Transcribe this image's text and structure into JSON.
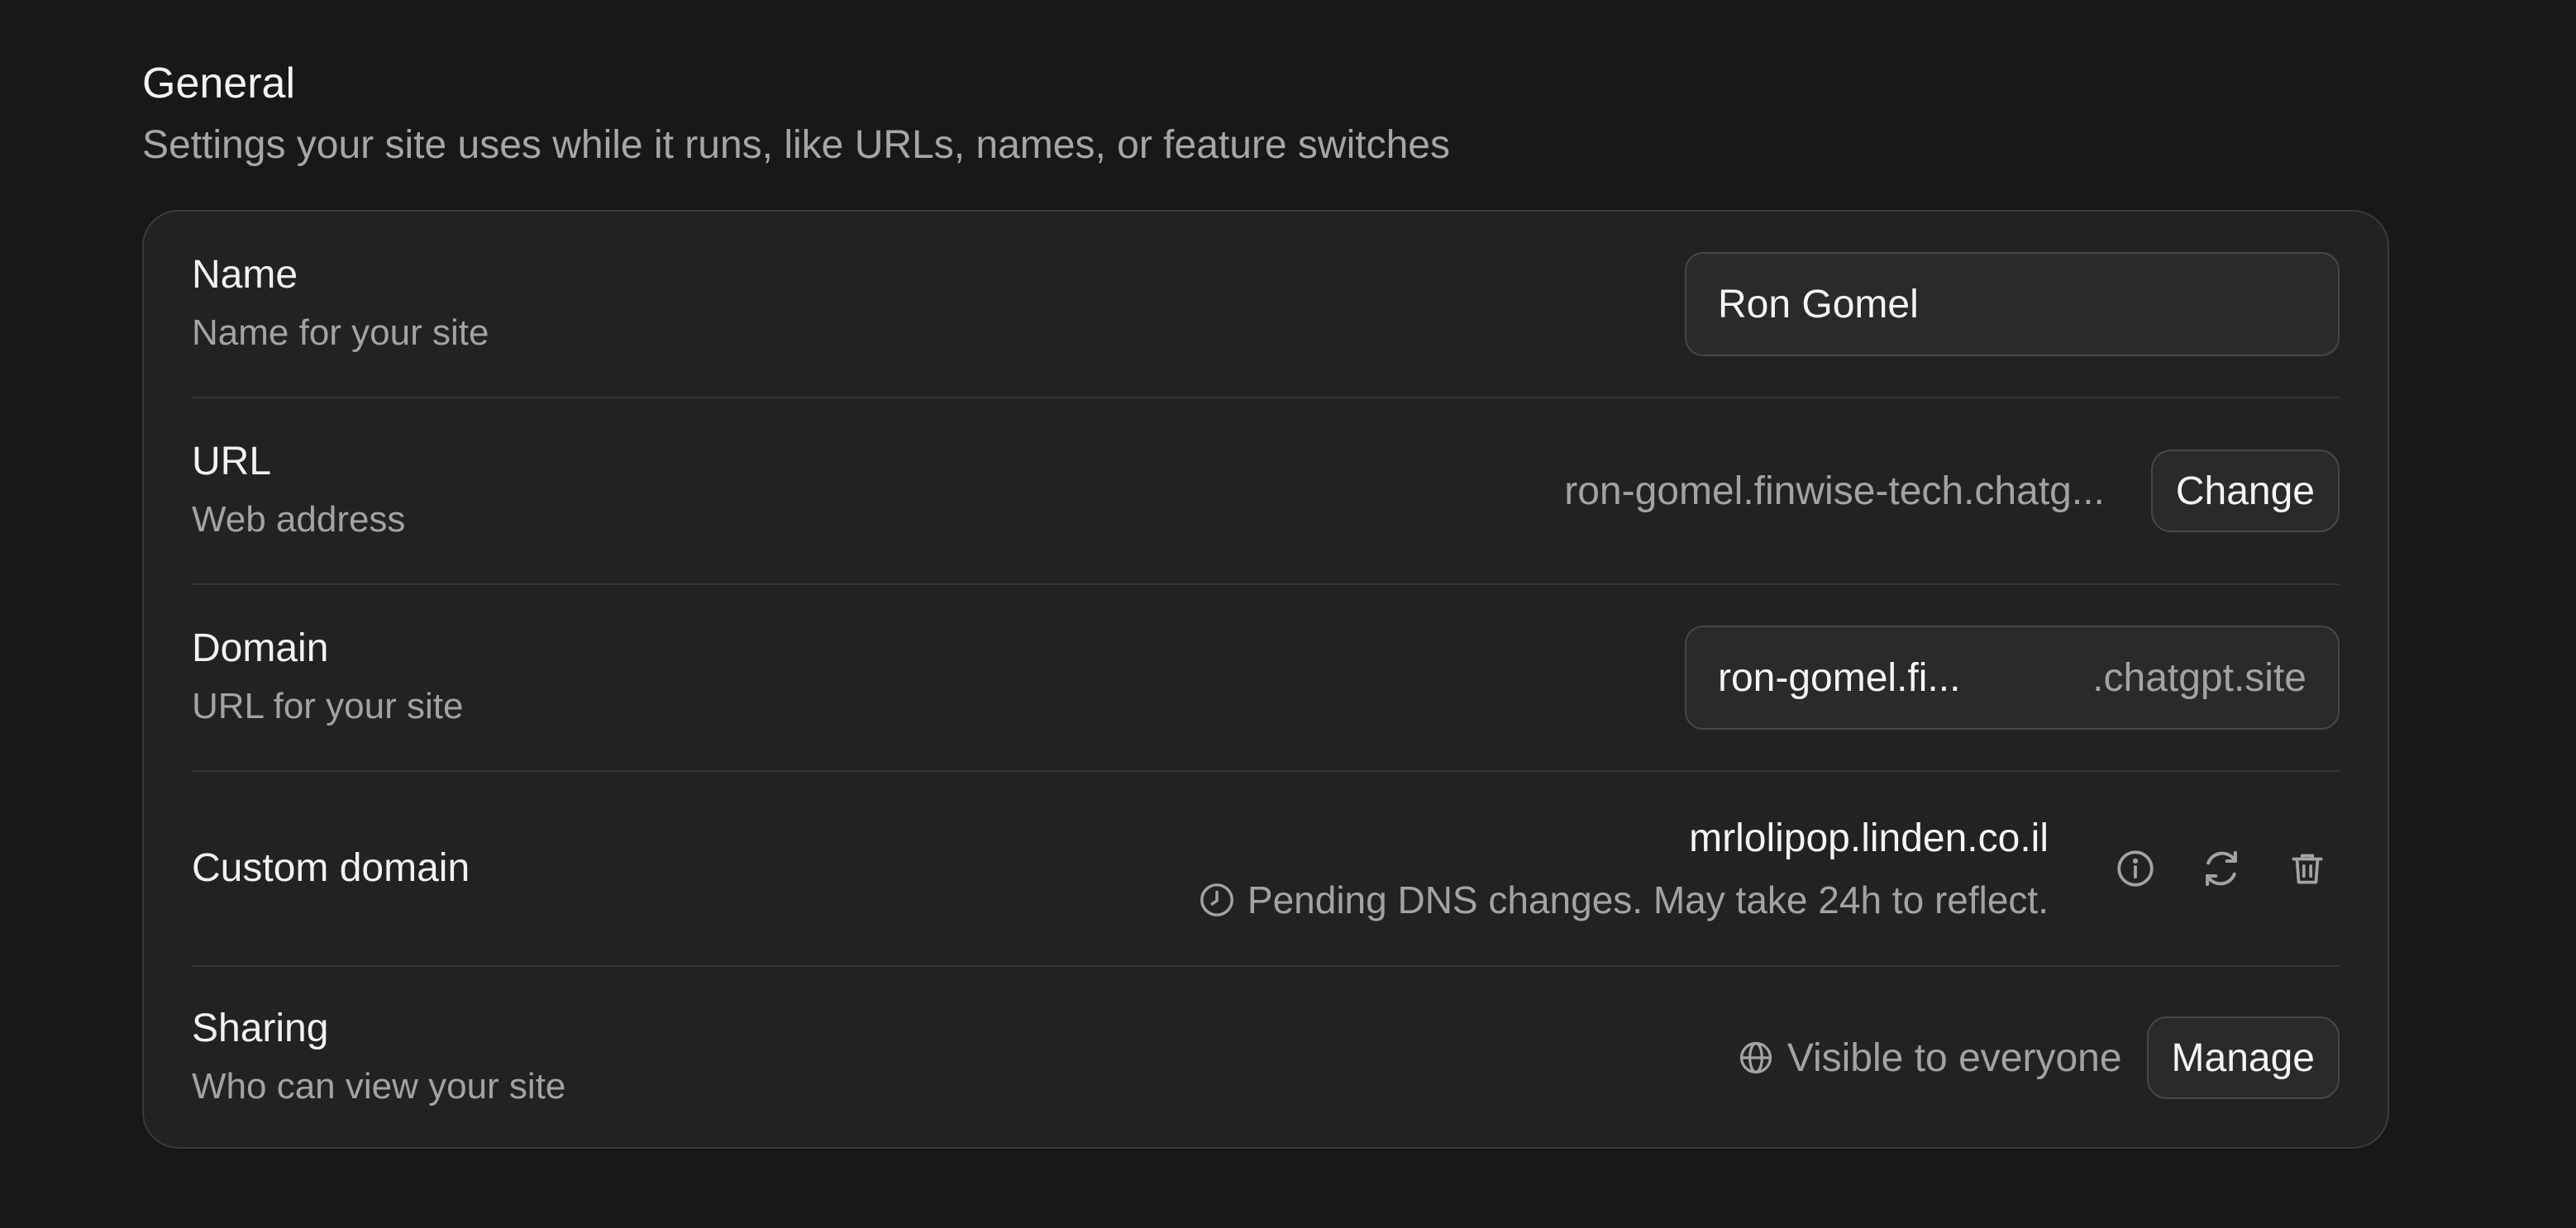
{
  "section": {
    "title": "General",
    "subtitle": "Settings your site uses while it runs, like URLs, names, or feature switches"
  },
  "name_row": {
    "label": "Name",
    "description": "Name for your site",
    "value": "Ron Gomel"
  },
  "url_row": {
    "label": "URL",
    "description": "Web address",
    "value": "ron-gomel.finwise-tech.chatg...",
    "button_label": "Change"
  },
  "domain_row": {
    "label": "Domain",
    "description": "URL for your site",
    "prefix": "ron-gomel.fi...",
    "suffix": ".chatgpt.site"
  },
  "custom_domain_row": {
    "label": "Custom domain",
    "value": "mrlolipop.linden.co.il",
    "status": "Pending DNS changes. May take 24h to reflect.",
    "icons": [
      "info-icon",
      "refresh-icon",
      "trash-icon"
    ]
  },
  "sharing_row": {
    "label": "Sharing",
    "description": "Who can view your site",
    "visibility": "Visible to everyone",
    "button_label": "Manage"
  },
  "colors": {
    "background": "#181818",
    "card": "#222222",
    "text_primary": "#f5f5f5",
    "text_secondary": "#a3a3a3",
    "border": "#474747"
  }
}
